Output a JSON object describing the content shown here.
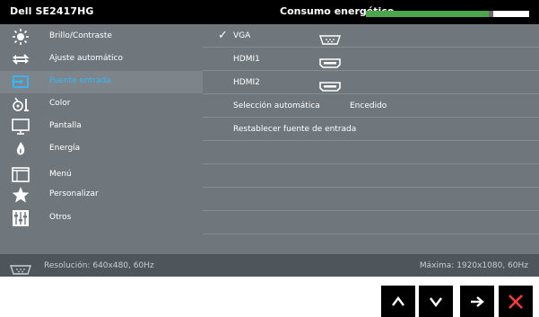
{
  "header": {
    "model": "Dell SE2417HG",
    "energy_label": "Consumo energético",
    "energy_level_fraction": 0.75,
    "energy_bar_color": "#4ca64c"
  },
  "sidebar": {
    "items": [
      {
        "label": "Brillo/Contraste",
        "icon": "brightness-icon",
        "active": false
      },
      {
        "label": "Ajuste  automático",
        "icon": "auto-adjust-icon",
        "active": false
      },
      {
        "label": "Fuente entrada",
        "icon": "input-source-icon",
        "active": true
      },
      {
        "label": "Color",
        "icon": "color-icon",
        "active": false
      },
      {
        "label": "Pantalla",
        "icon": "display-icon",
        "active": false
      },
      {
        "label": "Energía",
        "icon": "energy-icon",
        "active": false
      },
      {
        "label": "Menú",
        "icon": "menu-icon",
        "active": false
      },
      {
        "label": "Personalizar",
        "icon": "star-icon",
        "active": false
      },
      {
        "label": "Otros",
        "icon": "others-icon",
        "active": false
      }
    ],
    "active_color": "#33b8ff"
  },
  "main": {
    "rows": [
      {
        "label": "VGA",
        "checked": true,
        "connector": "vga-connector-icon"
      },
      {
        "label": "HDMI1",
        "checked": false,
        "connector": "hdmi-connector-icon"
      },
      {
        "label": "HDMI2",
        "checked": false,
        "connector": "hdmi-connector-icon"
      },
      {
        "label": "Selección automática",
        "value": "Encedido"
      },
      {
        "label": "Restablecer fuente de entrada"
      }
    ],
    "check_mark": "✓"
  },
  "status": {
    "resolution": "Resolución: 640x480, 60Hz",
    "max": "Máxima: 1920x1080, 60Hz"
  },
  "nav": {
    "buttons": [
      "up-arrow-icon",
      "down-arrow-icon",
      "right-arrow-icon",
      "close-icon"
    ],
    "close_color": "#ff3b3b"
  }
}
